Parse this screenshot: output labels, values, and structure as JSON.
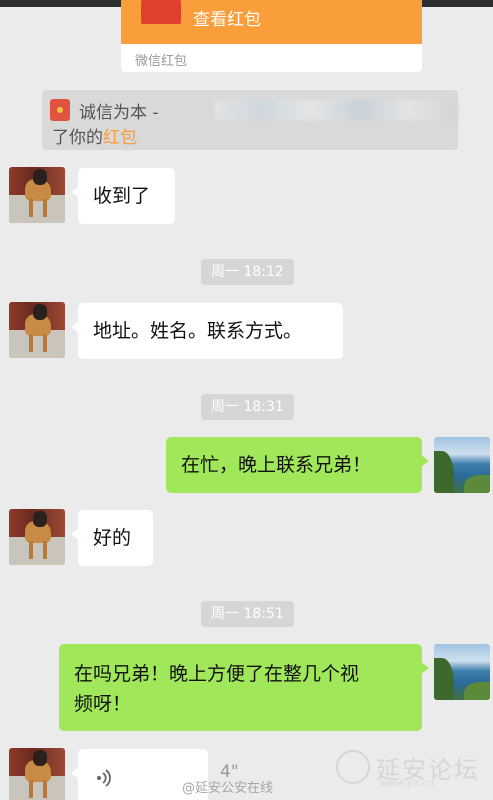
{
  "red_packet": {
    "title": "查看红包",
    "label": "微信红包"
  },
  "notice": {
    "line1_prefix": "诚信为本 -",
    "line2_prefix": "了你的",
    "line2_link": "红包"
  },
  "messages": [
    {
      "side": "in",
      "text": "收到了"
    },
    {
      "time": "周一 18:12"
    },
    {
      "side": "in",
      "text": "地址。姓名。联系方式。"
    },
    {
      "time": "周一 18:31"
    },
    {
      "side": "out",
      "text": "在忙，晚上联系兄弟！"
    },
    {
      "side": "in",
      "text": "好的"
    },
    {
      "time": "周一 18:51"
    },
    {
      "side": "out",
      "text_line1": "在吗兄弟！晚上方便了在整几个视",
      "text_line2": "频呀！"
    },
    {
      "side": "in",
      "type": "voice",
      "duration": "4\""
    }
  ],
  "watermarks": {
    "weibo": "@延安公安在线",
    "forum_name": "延安论坛",
    "forum_url": "www.ya.cn"
  },
  "colors": {
    "background": "#ebebeb",
    "bubble_in": "#ffffff",
    "bubble_out": "#a0e75a",
    "red_packet": "#fa9d3b",
    "link": "#fa9d3b"
  },
  "icons": {
    "voice": "voice-wave-icon",
    "red_packet_small": "red-packet-icon",
    "red_packet_large": "red-packet-icon"
  }
}
